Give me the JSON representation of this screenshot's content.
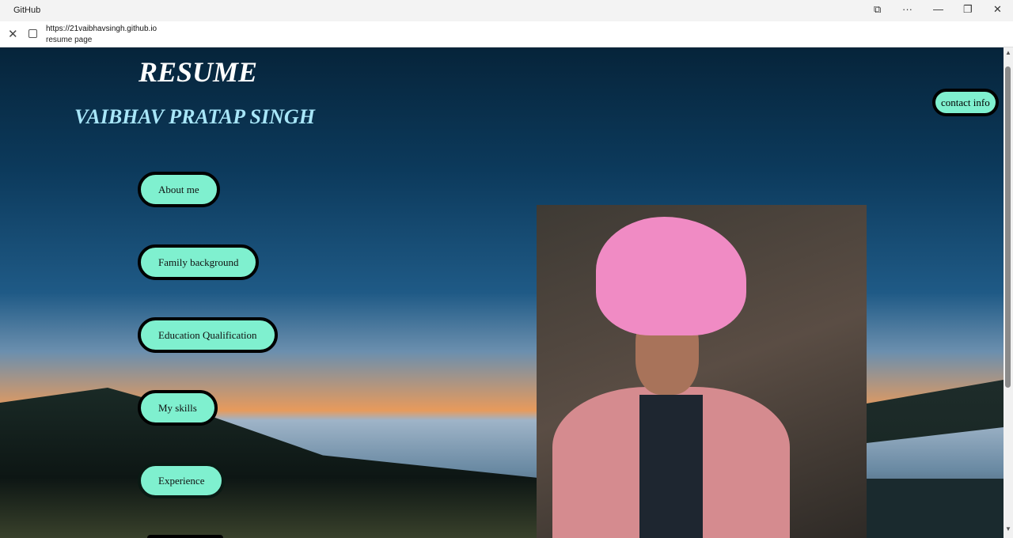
{
  "browser": {
    "window_title": "GitHub",
    "url": "https://21vaibhavsingh.github.io",
    "page_title": "resume page"
  },
  "page": {
    "heading": "RESUME",
    "name": "VAIBHAV PRATAP SINGH",
    "contact_label": "contact info",
    "nav": [
      {
        "label": "About me"
      },
      {
        "label": "Family background"
      },
      {
        "label": "Education Qualification"
      },
      {
        "label": "My skills"
      },
      {
        "label": "Experience"
      }
    ]
  },
  "colors": {
    "button": "#7ff0cf",
    "name": "#a8e6f8"
  }
}
